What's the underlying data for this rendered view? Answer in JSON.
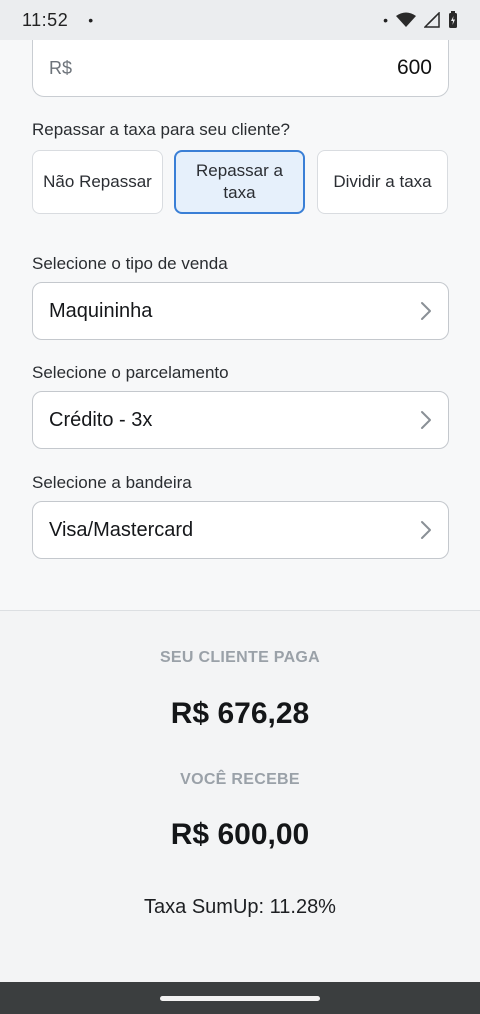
{
  "status_bar": {
    "time": "11:52",
    "left_dot": "•",
    "right_dot": "•"
  },
  "amount": {
    "prefix": "R$",
    "value": "600"
  },
  "pass_fee": {
    "question": "Repassar a taxa para seu cliente?",
    "options": [
      {
        "label": "Não Repassar",
        "selected": false
      },
      {
        "label": "Repassar a taxa",
        "selected": true
      },
      {
        "label": "Dividir a taxa",
        "selected": false
      }
    ]
  },
  "sale_type": {
    "label": "Selecione o tipo de venda",
    "value": "Maquininha"
  },
  "installments": {
    "label": "Selecione o parcelamento",
    "value": "Crédito - 3x"
  },
  "card_brand": {
    "label": "Selecione a bandeira",
    "value": "Visa/Mastercard"
  },
  "result": {
    "client_pays_label": "SEU CLIENTE PAGA",
    "client_pays_value": "R$ 676,28",
    "you_receive_label": "VOCÊ RECEBE",
    "you_receive_value": "R$ 600,00",
    "fee_text": "Taxa SumUp: 11.28%"
  },
  "colors": {
    "accent": "#3a7fd6",
    "accent_bg": "#e6f0fb",
    "caption": "#9aa1a8"
  }
}
